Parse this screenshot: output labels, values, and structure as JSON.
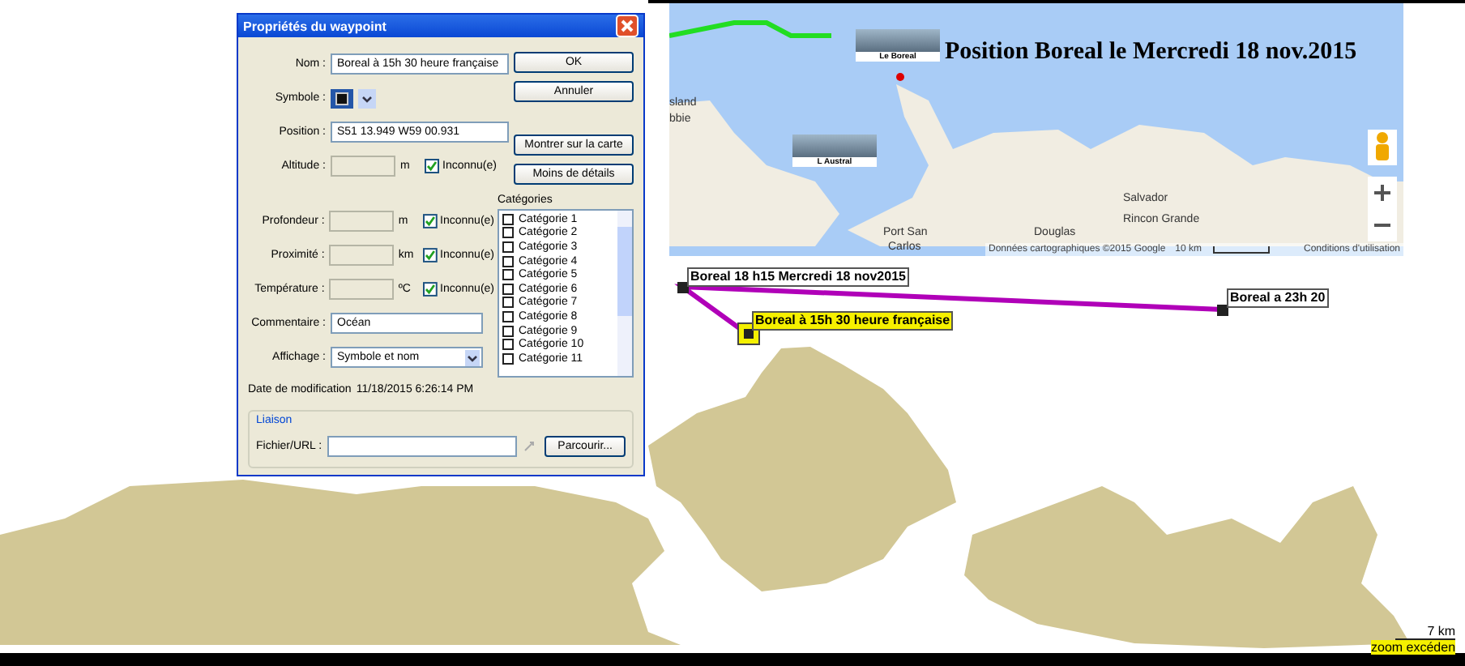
{
  "dialog": {
    "title": "Propriétés du waypoint",
    "fields_top": [
      {
        "kind": "text",
        "label": "Nom :",
        "value": "Boreal à 15h 30 heure française"
      },
      {
        "kind": "symbol",
        "label": "Symbole :"
      },
      {
        "kind": "text",
        "label": "Position :",
        "value": "S51 13.949 W59 00.931"
      },
      {
        "kind": "unit",
        "label": "Altitude :",
        "unit": "m",
        "check_label": "Inconnu(e)",
        "checked": true
      }
    ],
    "buttons": [
      "OK",
      "Annuler"
    ],
    "buttons_lower": [
      "Montrer sur la carte",
      "Moins de détails"
    ],
    "fields_bottom": [
      {
        "kind": "unit",
        "label": "Profondeur :",
        "unit": "m",
        "check_label": "Inconnu(e)",
        "checked": true
      },
      {
        "kind": "unit",
        "label": "Proximité :",
        "unit": "km",
        "check_label": "Inconnu(e)",
        "checked": true
      },
      {
        "kind": "unit",
        "label": "Température :",
        "unit": "ºC",
        "check_label": "Inconnu(e)",
        "checked": true
      },
      {
        "kind": "text",
        "label": "Commentaire :",
        "value": "Océan"
      },
      {
        "kind": "select",
        "label": "Affichage :",
        "value": "Symbole et nom"
      }
    ],
    "modified": {
      "label": "Date de modification",
      "value": "11/18/2015 6:26:14 PM"
    },
    "categories": {
      "title": "Catégories",
      "items": [
        {
          "label": "Catégorie 1",
          "checked": false
        },
        {
          "label": "Catégorie 2",
          "checked": false
        },
        {
          "label": "Catégorie 3",
          "checked": false
        },
        {
          "label": "Catégorie 4",
          "checked": false
        },
        {
          "label": "Catégorie 5",
          "checked": false
        },
        {
          "label": "Catégorie 6",
          "checked": false
        },
        {
          "label": "Catégorie 7",
          "checked": false
        },
        {
          "label": "Catégorie 8",
          "checked": false
        },
        {
          "label": "Catégorie 9",
          "checked": false
        },
        {
          "label": "Catégorie 10",
          "checked": false
        },
        {
          "label": "Catégorie 11",
          "checked": false
        }
      ]
    },
    "link": {
      "title": "Liaison",
      "label": "Fichier/URL :",
      "browse": "Parcourir..."
    }
  },
  "map_inset": {
    "title": "Position Boreal le Mercredi 18 nov.2015",
    "ships": [
      {
        "caption": "Le Boreal"
      },
      {
        "caption": "L Austral"
      }
    ],
    "places": [
      "sland",
      "bbie",
      "Douglas",
      "Salvador",
      "Rincon Grande",
      "Port San",
      "Carlos"
    ],
    "attribution": "Données cartographiques ©2015 Google",
    "scale": "10 km",
    "terms": "Conditions d'utilisation"
  },
  "chart": {
    "waypoints": [
      {
        "label": "Boreal 18 h15 Mercredi 18 nov2015",
        "selected": false
      },
      {
        "label": "Boreal a 23h 20",
        "selected": false
      },
      {
        "label": "Boreal à 15h 30 heure française",
        "selected": true
      }
    ],
    "scale": "7 km",
    "zoom_notice": "zoom excéden"
  }
}
